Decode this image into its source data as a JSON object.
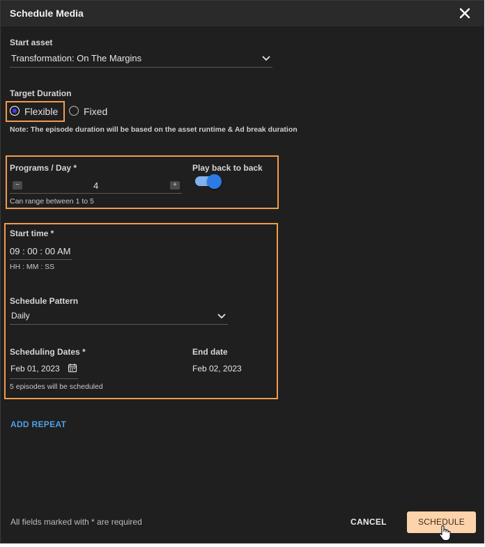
{
  "dialog": {
    "title": "Schedule Media"
  },
  "start_asset": {
    "label": "Start asset",
    "value": "Transformation: On The Margins"
  },
  "target_duration": {
    "label": "Target Duration",
    "options": [
      "Flexible",
      "Fixed"
    ],
    "selected": "Flexible",
    "note": "Note: The episode duration will be based on the asset runtime & Ad break duration"
  },
  "programs": {
    "label": "Programs / Day *",
    "value": "4",
    "minus": "−",
    "plus": "+",
    "hint": "Can range between 1 to 5"
  },
  "play_back": {
    "label": "Play back to back",
    "on": true
  },
  "start_time": {
    "label": "Start time *",
    "value": "09 : 00 : 00 AM",
    "hint": "HH : MM : SS"
  },
  "pattern": {
    "label": "Schedule Pattern",
    "value": "Daily"
  },
  "dates": {
    "label": "Scheduling Dates *",
    "value": "Feb 01, 2023",
    "end_label": "End date",
    "end_value": "Feb 02, 2023",
    "hint": "5 episodes will be scheduled"
  },
  "actions": {
    "add_repeat": "ADD REPEAT",
    "required_note": "All fields marked with * are required",
    "cancel": "CANCEL",
    "schedule": "SCHEDULE"
  },
  "colors": {
    "accent_highlight": "#f29c4c",
    "primary_button": "#fdd3ab",
    "link": "#4ea0e8",
    "toggle": "#2c7be5",
    "radio_selected": "#4b36ff"
  }
}
